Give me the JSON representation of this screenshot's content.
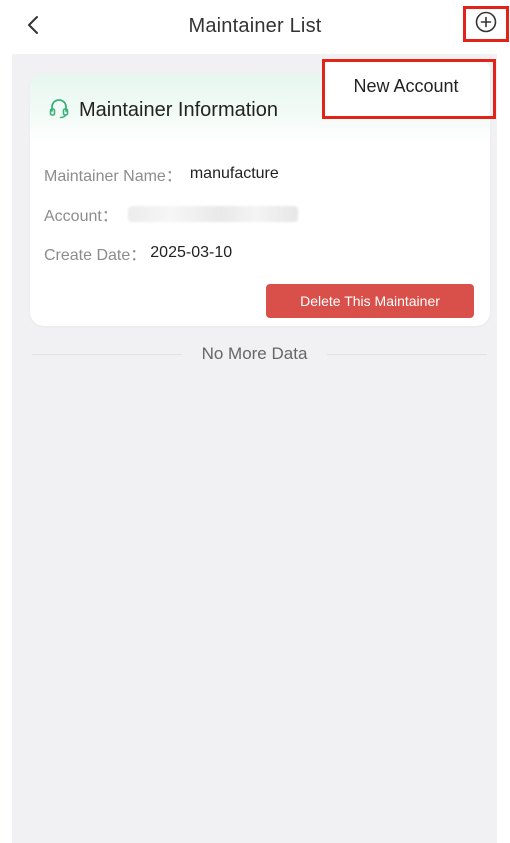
{
  "header": {
    "title": "Maintainer List",
    "back_icon": "chevron-left-icon",
    "add_icon": "plus-circle-icon"
  },
  "popup": {
    "label": "New Account"
  },
  "card": {
    "title": "Maintainer Information",
    "title_icon": "headset-icon",
    "name_label": "Maintainer Name：",
    "name_value": "manufacture",
    "account_label": "Account：",
    "date_label": "Create Date：",
    "date_value": "2025-03-10",
    "delete_label": "Delete This Maintainer"
  },
  "footer": {
    "no_more_text": "No More Data"
  },
  "colors": {
    "accent_green": "#3bb27a",
    "delete_red": "#d9504a",
    "highlight_red": "#e2231a",
    "background": "#f1f1f3"
  }
}
